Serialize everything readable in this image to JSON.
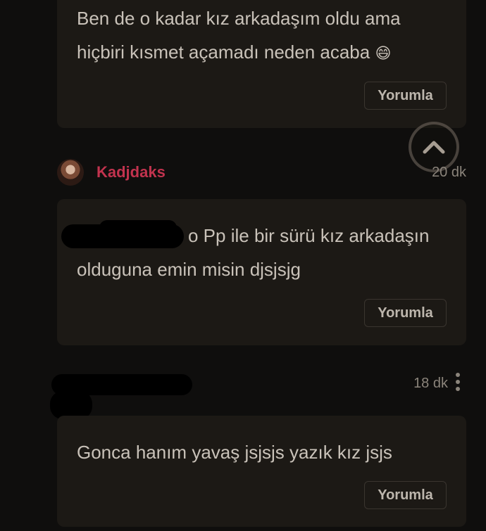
{
  "comments": [
    {
      "text_line1": "Ben de o kadar kız arkadaşım oldu ama",
      "text_line2": "hiçbiri kısmet açamadı neden acaba",
      "emoji": "😄",
      "reply_label": "Yorumla"
    },
    {
      "author": "Kadjdaks",
      "time": "20 dk",
      "text_line1": "o Pp ile bir sürü kız arkadaşın",
      "text_line2": "olduguna emin misin djsjsjg",
      "reply_label": "Yorumla"
    },
    {
      "time": "18 dk",
      "text_line1": "Gonca hanım yavaş jsjsjs yazık kız jsjs",
      "reply_label": "Yorumla"
    }
  ],
  "scroll_top_icon": "chevron-up-icon",
  "more_icon": "more-vertical-icon",
  "colors": {
    "username": "#c2334e",
    "card": "#1c1915",
    "background": "#0f0e0d"
  }
}
